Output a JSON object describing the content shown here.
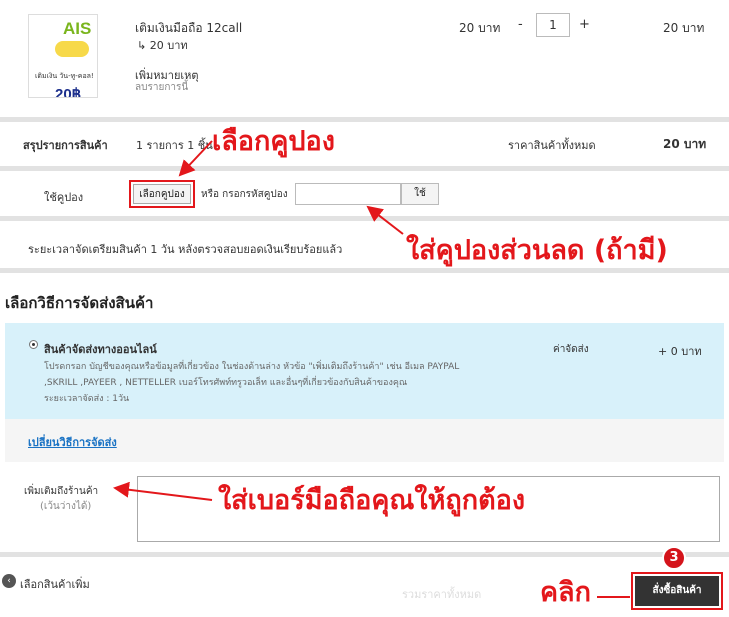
{
  "product": {
    "image": {
      "brand": "AIS",
      "badge": "12call",
      "note": "เติมเงิน วัน-ทู-คอล!",
      "price": "20฿"
    },
    "name": "เติมเงินมือถือ 12call",
    "sub": "↳ 20 บาท",
    "note_label": "เพิ่มหมายเหตุ",
    "remove": "ลบรายการนี้",
    "unit_price": "20 บาท",
    "qty_minus": "-",
    "quantity": "1",
    "qty_plus": "+",
    "line_total": "20 บาท"
  },
  "summary": {
    "label": "สรุปรายการสินค้า",
    "count": "1 รายการ 1 ชิ้น",
    "total_label": "ราคาสินค้าทั้งหมด",
    "total": "20 บาท"
  },
  "coupon": {
    "label": "ใช้คูปอง",
    "choose_button": "เลือกคูปอง",
    "or_text": "หรือ กรอกรหัสคูปอง",
    "code_value": "",
    "use_button": "ใช้"
  },
  "prep_time": "ระยะเวลาจัดเตรียมสินค้า 1 วัน หลังตรวจสอบยอดเงินเรียบร้อยแล้ว",
  "shipping": {
    "heading": "เลือกวิธีการจัดส่งสินค้า",
    "option_name": "สินค้าจัดส่งทางออนไลน์",
    "desc_line1": "โปรดกรอก บัญชีของคุณหรือข้อมูลที่เกี่ยวข้อง ในช่องด้านล่าง หัวข้อ \"เพิ่มเติมถึงร้านค้า\" เช่น อีเมล PAYPAL",
    "desc_line2": ",SKRILL ,PAYEER , NETTELLER เบอร์โทรศัพท์ทรูวอเล็ท และอื่นๆที่เกี่ยวข้องกับสินค้าของคุณ",
    "desc_line3": "ระยะเวลาจัดส่ง :   1วัน",
    "cost_label": "ค่าจัดส่ง",
    "cost": "+ 0 บาท",
    "change_link": "เปลี่ยนวิธีการจัดส่ง"
  },
  "note": {
    "label": "เพิ่มเติมถึงร้านค้า",
    "optional": "(เว้นว่างได้)",
    "value": ""
  },
  "footer": {
    "more_icon": "‹",
    "more_link": "เลือกสินค้าเพิ่ม",
    "grand_label": "รวมราคาทั้งหมด",
    "order_button": "สั่งซื้อสินค้า"
  },
  "annotations": {
    "choose_coupon": "เลือกคูปอง",
    "enter_discount": "ใส่คูปองส่วนลด (ถ้ามี)",
    "enter_phone": "ใส่เบอร์มือถือคุณให้ถูกต้อง",
    "click": "คลิก",
    "step": "3",
    "color": "#e3171b"
  }
}
